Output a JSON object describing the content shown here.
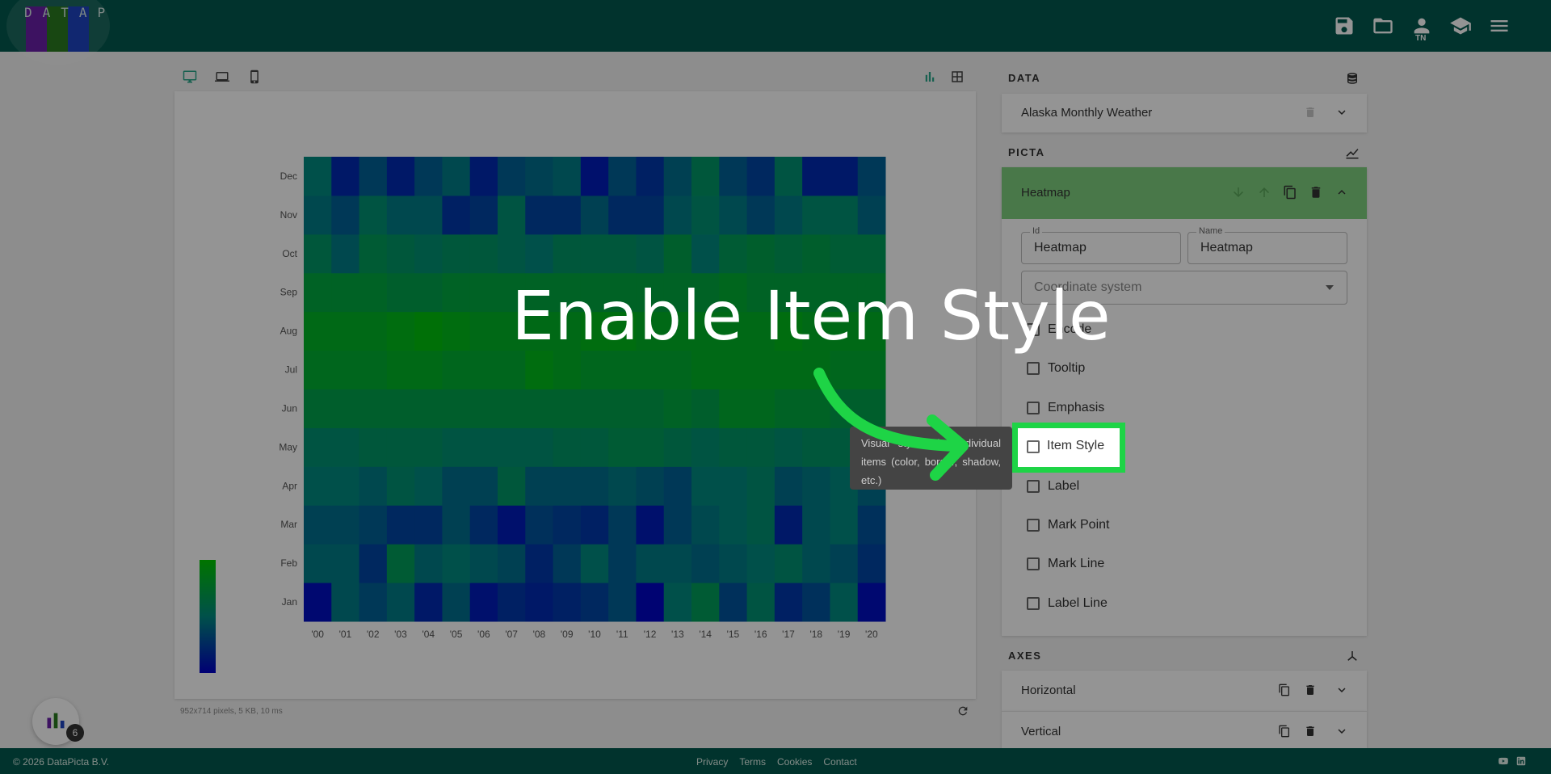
{
  "app": {
    "title": "DATAPICTA",
    "brand_colors": [
      "#6a1fa8",
      "#2a7a1f",
      "#1e44c2"
    ],
    "user_initials": "TN"
  },
  "toolbar": {
    "icons": [
      "save-icon",
      "folder-open-icon",
      "user-icon",
      "school-icon",
      "menu-icon"
    ]
  },
  "device_views": [
    "desktop-icon",
    "laptop-icon",
    "phone-icon"
  ],
  "view_modes": [
    "bar-chart-icon",
    "table-icon"
  ],
  "status": {
    "info": "952x714 pixels, 5 KB, 10 ms"
  },
  "data_panel": {
    "title": "DATA",
    "dataset": "Alaska Monthly Weather"
  },
  "picta_panel": {
    "title": "PICTA",
    "series_name": "Heatmap",
    "id_label": "Id",
    "id_value": "Heatmap",
    "name_label": "Name",
    "name_value": "Heatmap",
    "coordinate_placeholder": "Coordinate system",
    "options": [
      "Encode",
      "Tooltip",
      "Emphasis",
      "Item Style",
      "Label",
      "Mark Point",
      "Mark Line",
      "Label Line"
    ]
  },
  "axes_panel": {
    "title": "AXES",
    "items": [
      "Horizontal",
      "Vertical"
    ]
  },
  "fab": {
    "badge": "6"
  },
  "footer": {
    "copyright": "© 2026 DataPicta B.V.",
    "links": [
      "Privacy",
      "Terms",
      "Cookies",
      "Contact"
    ]
  },
  "tooltip": {
    "text": "Visual styling for individual items (color, border, shadow, etc.)"
  },
  "annotation": {
    "text": "Enable Item Style"
  },
  "colors": {
    "header": "#03594e",
    "accent": "#1ed446",
    "heatmap_low": "#0000c8",
    "heatmap_mid": "#008b80",
    "heatmap_high": "#00c800"
  },
  "chart_data": {
    "type": "heatmap",
    "x_categories": [
      "'00",
      "'01",
      "'02",
      "'03",
      "'04",
      "'05",
      "'06",
      "'07",
      "'08",
      "'09",
      "'10",
      "'11",
      "'12",
      "'13",
      "'14",
      "'15",
      "'16",
      "'17",
      "'18",
      "'19",
      "'20"
    ],
    "y_categories": [
      "Jan",
      "Feb",
      "Mar",
      "Apr",
      "May",
      "Jun",
      "Jul",
      "Aug",
      "Sep",
      "Oct",
      "Nov",
      "Dec"
    ],
    "values": [
      [
        0.05,
        0.45,
        0.35,
        0.45,
        0.15,
        0.4,
        0.1,
        0.2,
        0.15,
        0.2,
        0.25,
        0.35,
        0.02,
        0.5,
        0.65,
        0.3,
        0.55,
        0.2,
        0.3,
        0.5,
        0.05
      ],
      [
        0.45,
        0.45,
        0.25,
        0.65,
        0.45,
        0.5,
        0.45,
        0.4,
        0.2,
        0.35,
        0.5,
        0.35,
        0.45,
        0.45,
        0.4,
        0.45,
        0.5,
        0.55,
        0.45,
        0.4,
        0.25
      ],
      [
        0.4,
        0.4,
        0.35,
        0.25,
        0.25,
        0.4,
        0.25,
        0.1,
        0.3,
        0.25,
        0.2,
        0.35,
        0.1,
        0.35,
        0.45,
        0.5,
        0.55,
        0.15,
        0.45,
        0.5,
        0.3
      ],
      [
        0.5,
        0.5,
        0.45,
        0.55,
        0.5,
        0.4,
        0.4,
        0.6,
        0.4,
        0.4,
        0.4,
        0.45,
        0.4,
        0.35,
        0.5,
        0.5,
        0.55,
        0.4,
        0.45,
        0.5,
        0.4
      ],
      [
        0.55,
        0.55,
        0.6,
        0.6,
        0.6,
        0.55,
        0.55,
        0.55,
        0.55,
        0.6,
        0.6,
        0.65,
        0.65,
        0.6,
        0.55,
        0.6,
        0.6,
        0.55,
        0.6,
        0.6,
        0.55
      ],
      [
        0.7,
        0.7,
        0.7,
        0.7,
        0.7,
        0.7,
        0.7,
        0.7,
        0.7,
        0.7,
        0.7,
        0.7,
        0.7,
        0.75,
        0.7,
        0.8,
        0.8,
        0.75,
        0.75,
        0.7,
        0.7
      ],
      [
        0.8,
        0.8,
        0.8,
        0.85,
        0.85,
        0.8,
        0.8,
        0.8,
        0.9,
        0.85,
        0.8,
        0.8,
        0.8,
        0.8,
        0.85,
        0.85,
        0.85,
        0.85,
        0.85,
        0.8,
        0.8
      ],
      [
        0.85,
        0.85,
        0.85,
        0.9,
        0.95,
        0.9,
        0.85,
        0.85,
        0.85,
        0.85,
        0.9,
        0.9,
        0.85,
        0.85,
        0.85,
        0.85,
        0.85,
        0.9,
        0.85,
        0.85,
        0.85
      ],
      [
        0.75,
        0.75,
        0.75,
        0.7,
        0.7,
        0.75,
        0.75,
        0.75,
        0.75,
        0.75,
        0.75,
        0.75,
        0.75,
        0.75,
        0.75,
        0.8,
        0.75,
        0.75,
        0.75,
        0.75,
        0.75
      ],
      [
        0.6,
        0.45,
        0.65,
        0.6,
        0.55,
        0.6,
        0.6,
        0.55,
        0.5,
        0.6,
        0.6,
        0.6,
        0.55,
        0.7,
        0.5,
        0.65,
        0.7,
        0.65,
        0.7,
        0.65,
        0.65
      ],
      [
        0.45,
        0.35,
        0.55,
        0.45,
        0.45,
        0.2,
        0.25,
        0.55,
        0.25,
        0.25,
        0.4,
        0.25,
        0.25,
        0.45,
        0.55,
        0.45,
        0.35,
        0.45,
        0.55,
        0.55,
        0.4
      ],
      [
        0.5,
        0.15,
        0.35,
        0.15,
        0.35,
        0.45,
        0.15,
        0.35,
        0.4,
        0.45,
        0.1,
        0.35,
        0.2,
        0.4,
        0.6,
        0.35,
        0.25,
        0.55,
        0.15,
        0.15,
        0.35
      ]
    ]
  }
}
